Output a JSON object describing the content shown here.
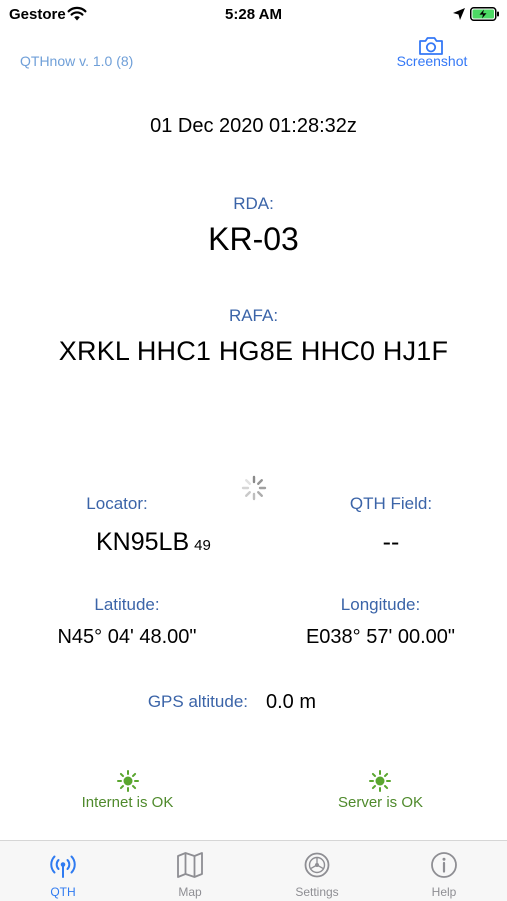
{
  "status_bar": {
    "carrier": "Gestore",
    "time": "5:28 AM"
  },
  "header": {
    "version": "QTHnow v. 1.0 (8)",
    "screenshot_label": "Screenshot"
  },
  "datetime": "01 Dec 2020 01:28:32z",
  "rda": {
    "label": "RDA:",
    "value": "KR-03"
  },
  "rafa": {
    "label": "RAFA:",
    "value": "XRKL HHC1 HG8E HHC0 HJ1F"
  },
  "locator": {
    "label": "Locator:",
    "value": "KN95LB",
    "sub": "49"
  },
  "qth_field": {
    "label": "QTH Field:",
    "value": "--"
  },
  "latitude": {
    "label": "Latitude:",
    "value": "N45° 04' 48.00\""
  },
  "longitude": {
    "label": "Longitude:",
    "value": "E038° 57' 00.00\""
  },
  "gps_altitude": {
    "label": "GPS altitude:",
    "value": "0.0 m"
  },
  "status": {
    "internet": "Internet is OK",
    "server": "Server is OK",
    "ok_color": "#4f8a2c"
  },
  "tabs": [
    {
      "label": "QTH",
      "icon": "antenna-icon",
      "active": true
    },
    {
      "label": "Map",
      "icon": "map-icon",
      "active": false
    },
    {
      "label": "Settings",
      "icon": "settings-icon",
      "active": false
    },
    {
      "label": "Help",
      "icon": "info-icon",
      "active": false
    }
  ],
  "colors": {
    "label_blue": "#3b64a8",
    "accent_blue": "#3478f6",
    "version_blue": "#6f9fd8",
    "tab_inactive": "#8e8e93"
  }
}
